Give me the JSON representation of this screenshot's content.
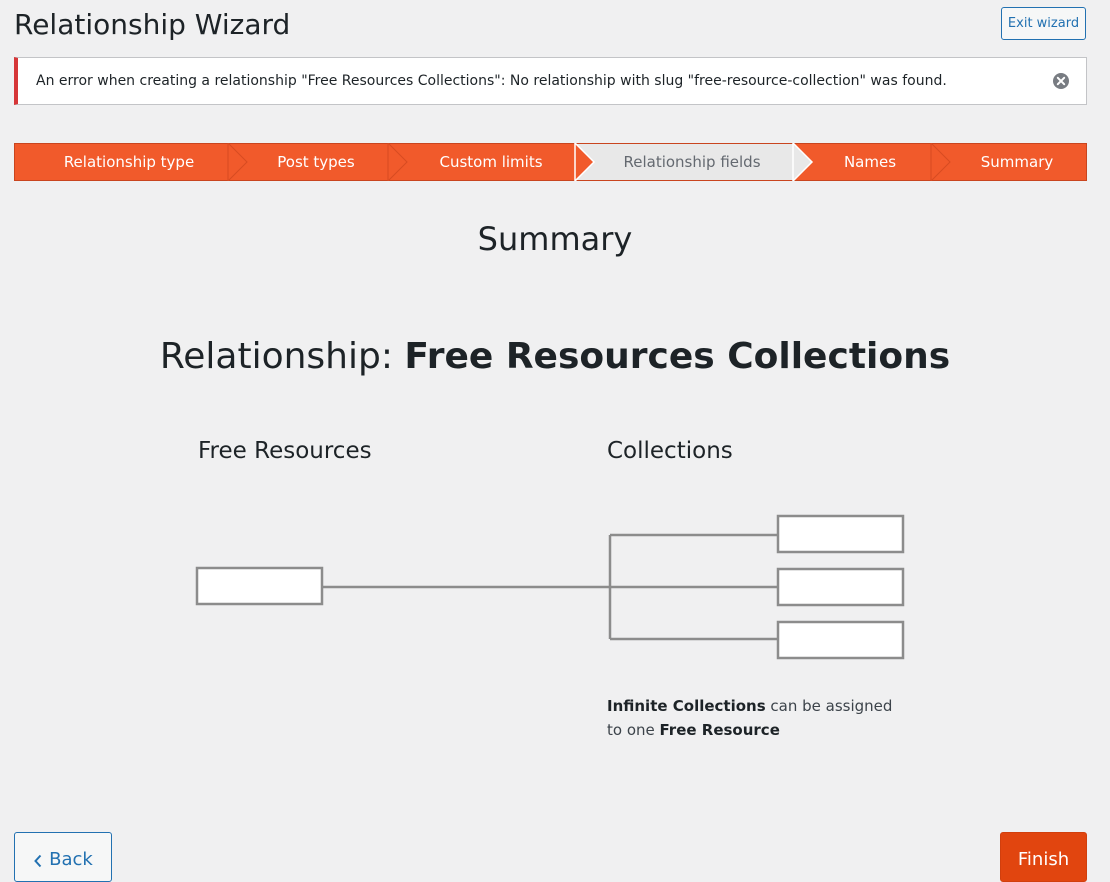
{
  "page": {
    "title": "Relationship Wizard",
    "exit_label": "Exit wizard"
  },
  "notice": {
    "text": "An error when creating a relationship \"Free Resources Collections\": No relationship with slug \"free-resource-collection\" was found.",
    "dismiss_icon": "close-circle-icon"
  },
  "steps": [
    {
      "label": "Relationship type",
      "state": "done"
    },
    {
      "label": "Post types",
      "state": "done"
    },
    {
      "label": "Custom limits",
      "state": "done"
    },
    {
      "label": "Relationship fields",
      "state": "skipped"
    },
    {
      "label": "Names",
      "state": "done"
    },
    {
      "label": "Summary",
      "state": "current"
    }
  ],
  "summary": {
    "section_title": "Summary",
    "heading_prefix": "Relationship: ",
    "heading_name": "Free Resources Collections",
    "left_label": "Free Resources",
    "right_label": "Collections",
    "desc_bold_1": "Infinite Collections",
    "desc_text_1": " can be assigned to one ",
    "desc_bold_2": "Free Resource"
  },
  "footer": {
    "back_label": "Back",
    "finish_label": "Finish"
  },
  "colors": {
    "step_active": "#f15a2b",
    "step_inactive": "#e8e8e8",
    "error_border": "#d63638",
    "link_blue": "#2271b1"
  }
}
